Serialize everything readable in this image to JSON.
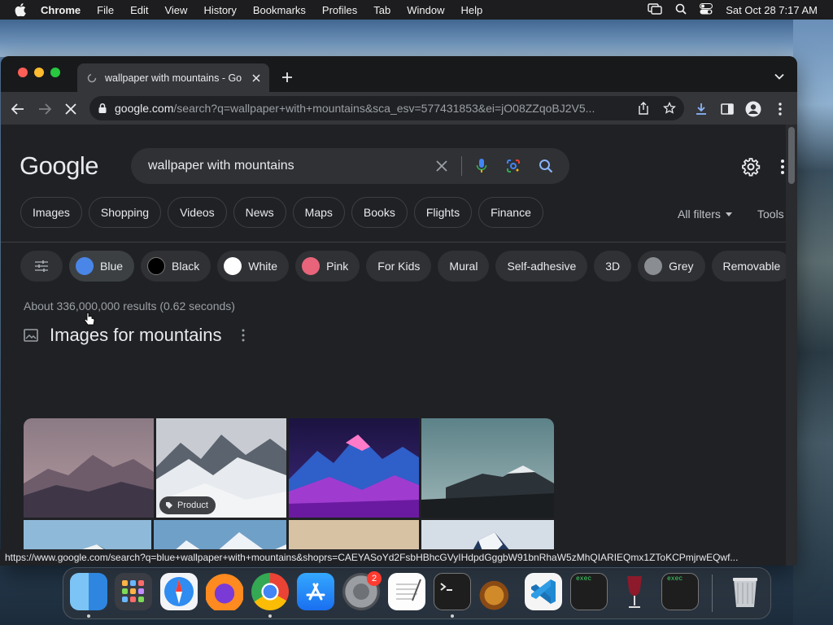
{
  "menubar": {
    "app_name": "Chrome",
    "items": [
      "File",
      "Edit",
      "View",
      "History",
      "Bookmarks",
      "Profiles",
      "Tab",
      "Window",
      "Help"
    ],
    "datetime": "Sat Oct 28  7:17 AM"
  },
  "browser": {
    "tab_title": "wallpaper with mountains - Go",
    "url_host": "google.com",
    "url_path": "/search?q=wallpaper+with+mountains&sca_esv=577431853&ei=jO08ZZqoBJ2V5..."
  },
  "google": {
    "logo": "Google",
    "query": "wallpaper with mountains",
    "nav_chips": [
      "Images",
      "Shopping",
      "Videos",
      "News",
      "Maps",
      "Books",
      "Flights",
      "Finance"
    ],
    "all_filters": "All filters",
    "tools": "Tools",
    "refine_chips": [
      {
        "label": "Blue",
        "swatch": "#4a86e8",
        "selected": true
      },
      {
        "label": "Black",
        "swatch": "#000000"
      },
      {
        "label": "White",
        "swatch": "#ffffff"
      },
      {
        "label": "Pink",
        "swatch": "#e8647a"
      },
      {
        "label": "For Kids"
      },
      {
        "label": "Mural"
      },
      {
        "label": "Self-adhesive"
      },
      {
        "label": "3D"
      },
      {
        "label": "Grey",
        "swatch": "#8a8d91"
      },
      {
        "label": "Removable"
      }
    ],
    "result_stats": "About 336,000,000 results (0.62 seconds)",
    "images_heading": "Images for mountains",
    "product_badge": "Product"
  },
  "status_url": "https://www.google.com/search?q=blue+wallpaper+with+mountains&shoprs=CAEYASoYd2FsbHBhcGVyIHdpdGggbW91bnRhaW5zMhQIARIEQmx1ZToKCPmjrwEQwf...",
  "dock": {
    "apps": [
      "Finder",
      "Launchpad",
      "Safari",
      "Firefox",
      "Chrome",
      "App Store",
      "System Settings",
      "TextEdit",
      "Terminal",
      "GarageBand",
      "Visual Studio Code",
      "exec",
      "Wine",
      "exec",
      "Trash"
    ],
    "settings_badge": "2",
    "exec_label": "exec"
  }
}
